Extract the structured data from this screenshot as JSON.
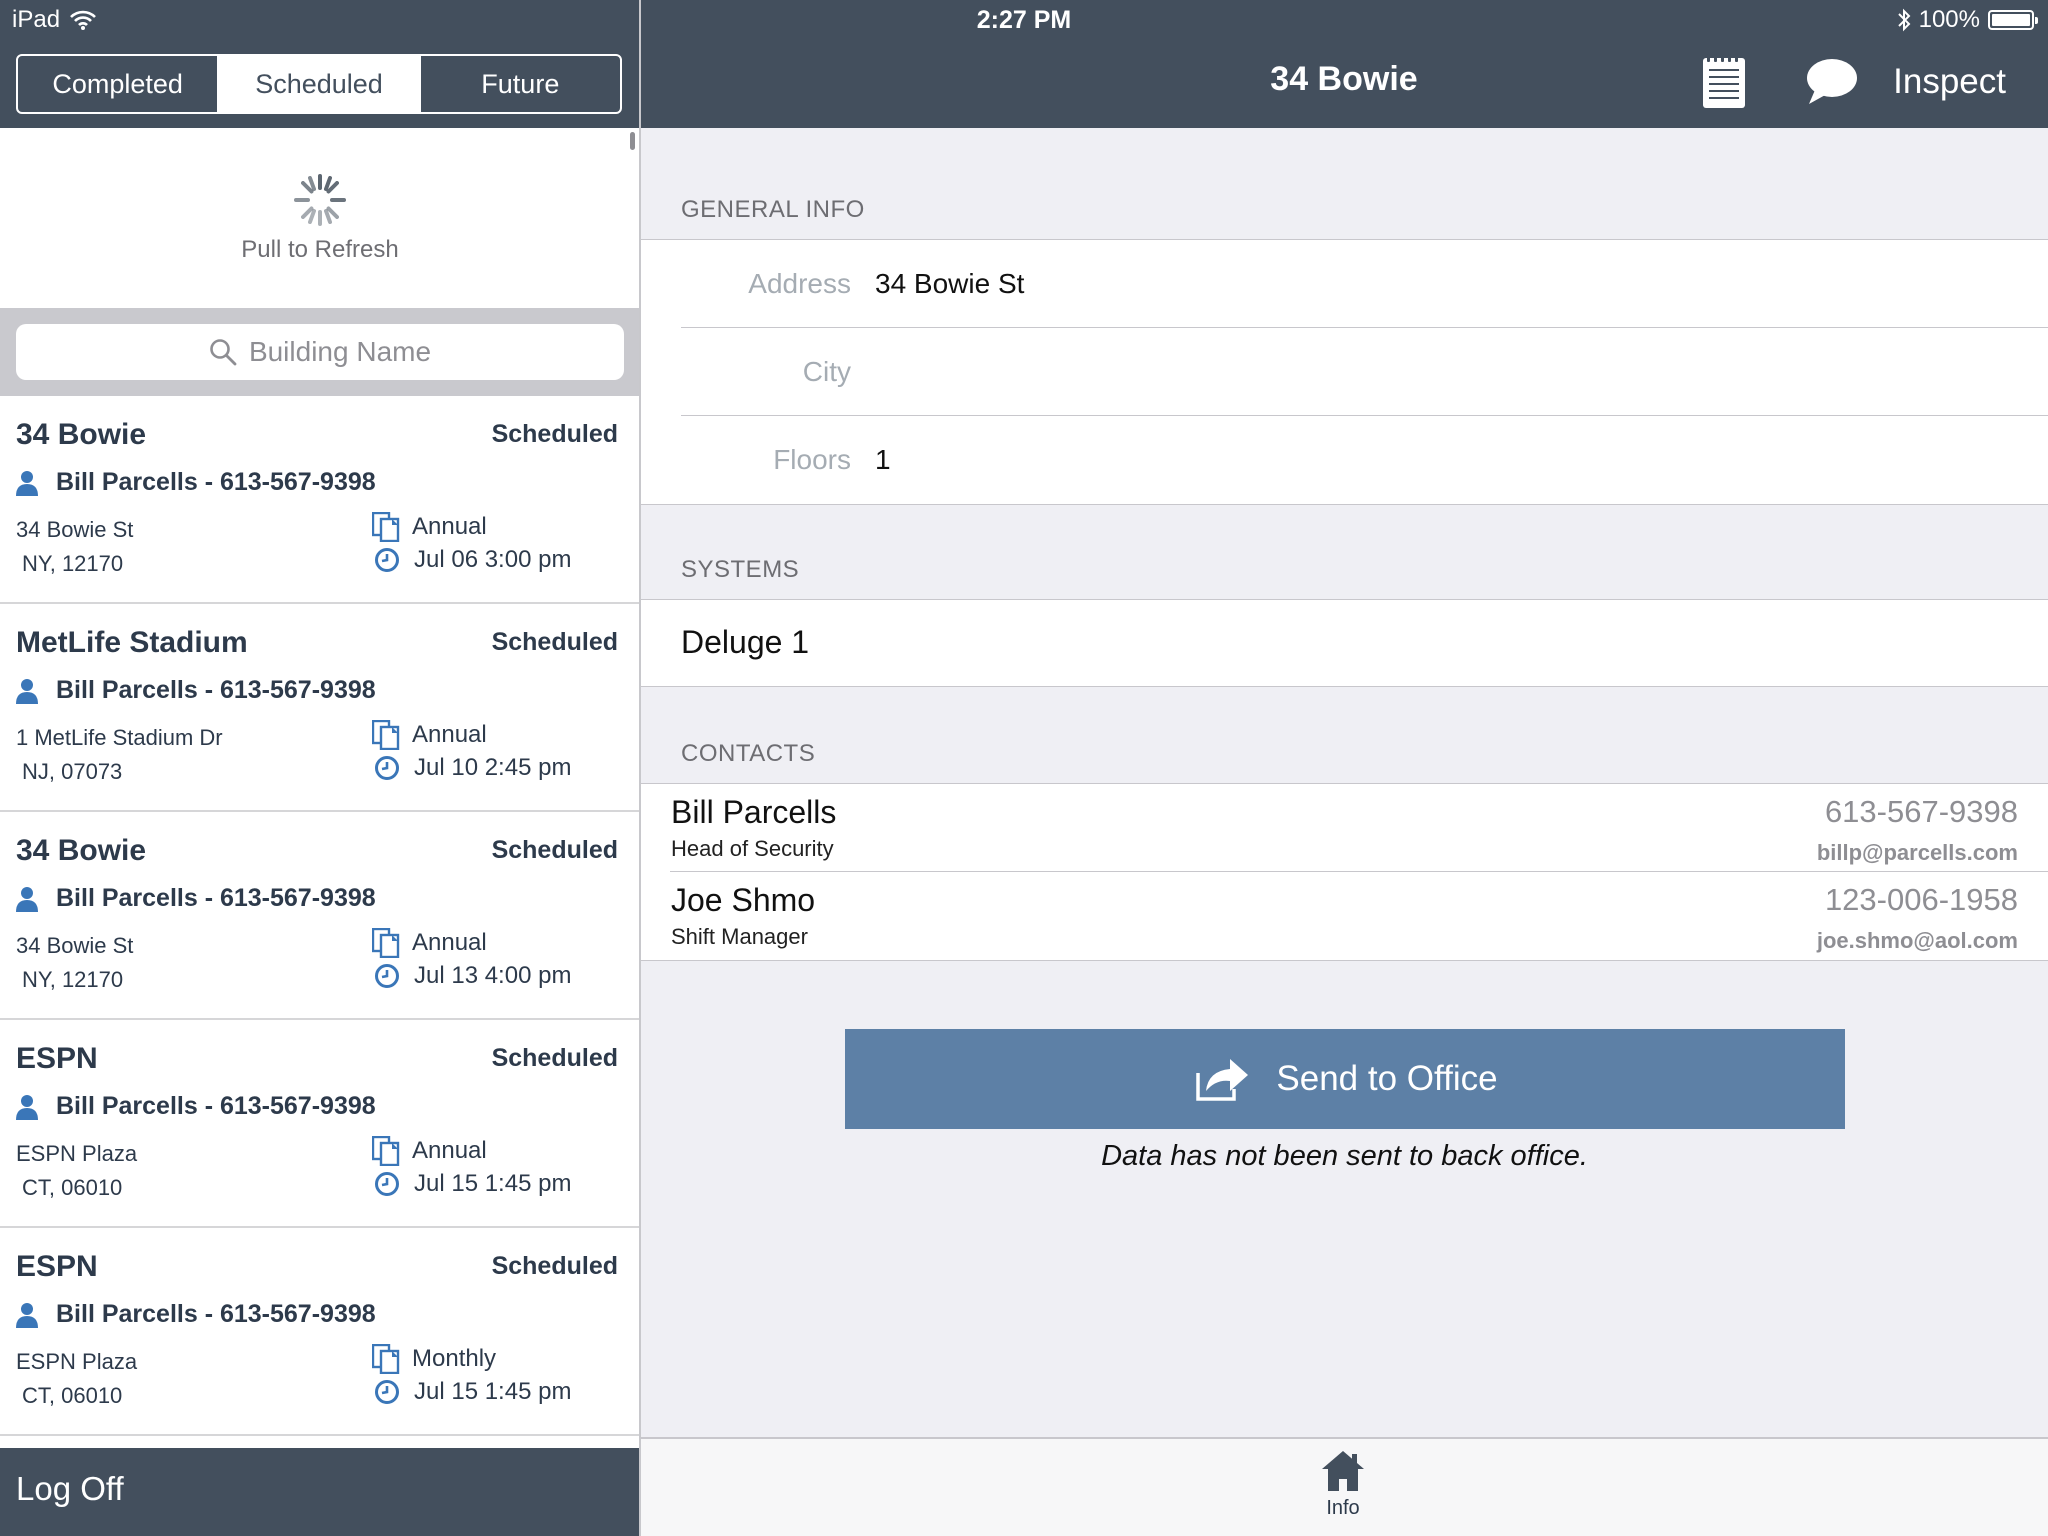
{
  "status_bar": {
    "device": "iPad",
    "time": "2:27 PM",
    "battery": "100%",
    "icons": [
      "wifi-icon",
      "bluetooth-icon",
      "battery-icon"
    ]
  },
  "segmented_control": {
    "segments": [
      "Completed",
      "Scheduled",
      "Future"
    ],
    "selected": "Scheduled"
  },
  "nav": {
    "title": "34 Bowie",
    "notes_icon": "notepad-icon",
    "chat_icon": "speech-bubble-icon",
    "inspect_label": "Inspect"
  },
  "list": {
    "refresh_text": "Pull to Refresh",
    "search_placeholder": "Building Name",
    "items": [
      {
        "name": "34 Bowie",
        "status": "Scheduled",
        "contact": "Bill Parcells - 613-567-9398",
        "address_line1": "34 Bowie St",
        "address_line2": "NY, 12170",
        "type": "Annual",
        "date": "Jul 06 3:00 pm"
      },
      {
        "name": "MetLife Stadium",
        "status": "Scheduled",
        "contact": "Bill Parcells - 613-567-9398",
        "address_line1": "1 MetLife Stadium Dr",
        "address_line2": "NJ, 07073",
        "type": "Annual",
        "date": "Jul 10 2:45 pm"
      },
      {
        "name": "34 Bowie",
        "status": "Scheduled",
        "contact": "Bill Parcells - 613-567-9398",
        "address_line1": "34 Bowie St",
        "address_line2": "NY, 12170",
        "type": "Annual",
        "date": "Jul 13 4:00 pm"
      },
      {
        "name": "ESPN",
        "status": "Scheduled",
        "contact": "Bill Parcells - 613-567-9398",
        "address_line1": "ESPN Plaza",
        "address_line2": "CT, 06010",
        "type": "Annual",
        "date": "Jul 15 1:45 pm"
      },
      {
        "name": "ESPN",
        "status": "Scheduled",
        "contact": "Bill Parcells - 613-567-9398",
        "address_line1": "ESPN Plaza",
        "address_line2": "CT, 06010",
        "type": "Monthly",
        "date": "Jul 15 1:45 pm"
      }
    ],
    "logoff_label": "Log Off"
  },
  "general_info": {
    "section_title": "GENERAL INFO",
    "fields": [
      {
        "label": "Address",
        "value": "34 Bowie St"
      },
      {
        "label": "City",
        "value": ""
      },
      {
        "label": "Floors",
        "value": "1"
      }
    ]
  },
  "systems": {
    "section_title": "SYSTEMS",
    "items": [
      "Deluge 1"
    ]
  },
  "contacts": {
    "section_title": "CONTACTS",
    "items": [
      {
        "name": "Bill Parcells",
        "role": "Head of Security",
        "phone": "613-567-9398",
        "email": "billp@parcells.com"
      },
      {
        "name": "Joe Shmo",
        "role": "Shift Manager",
        "phone": "123-006-1958",
        "email": "joe.shmo@aol.com"
      }
    ]
  },
  "send": {
    "button_label": "Send to Office",
    "note": "Data has not been sent to back office."
  },
  "tabbar": {
    "tabs": [
      {
        "label": "Info",
        "icon": "home-icon"
      }
    ]
  },
  "colors": {
    "bar": "#434f5d",
    "accent": "#5d80a6",
    "icon_blue": "#3a76b8",
    "panel_bg": "#efeff4"
  }
}
